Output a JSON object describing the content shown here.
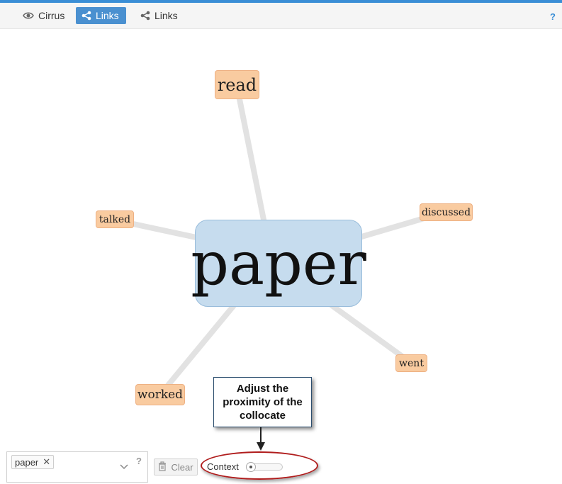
{
  "tabs": [
    {
      "label": "Cirrus",
      "icon": "eye-icon",
      "active": false
    },
    {
      "label": "Links",
      "icon": "share-icon",
      "active": true
    },
    {
      "label": "Links",
      "icon": "share-icon",
      "active": false
    }
  ],
  "help_top": "?",
  "graph": {
    "center": {
      "term": "paper"
    },
    "collocates": [
      {
        "term": "read"
      },
      {
        "term": "talked"
      },
      {
        "term": "discussed"
      },
      {
        "term": "went"
      },
      {
        "term": "worked"
      }
    ]
  },
  "callout": {
    "text": "Adjust the proximity of the collocate"
  },
  "controls": {
    "search_token": "paper",
    "token_remove": "✕",
    "help_q": "?",
    "clear_label": "Clear",
    "context_label": "Context"
  },
  "colors": {
    "accent": "#3a8ed6",
    "active_tab": "#4a90d0",
    "node_fill": "#f9cba0",
    "center_fill": "#c6dcee",
    "link": "#e2e2e2",
    "highlight_ellipse": "#b01c1c"
  }
}
